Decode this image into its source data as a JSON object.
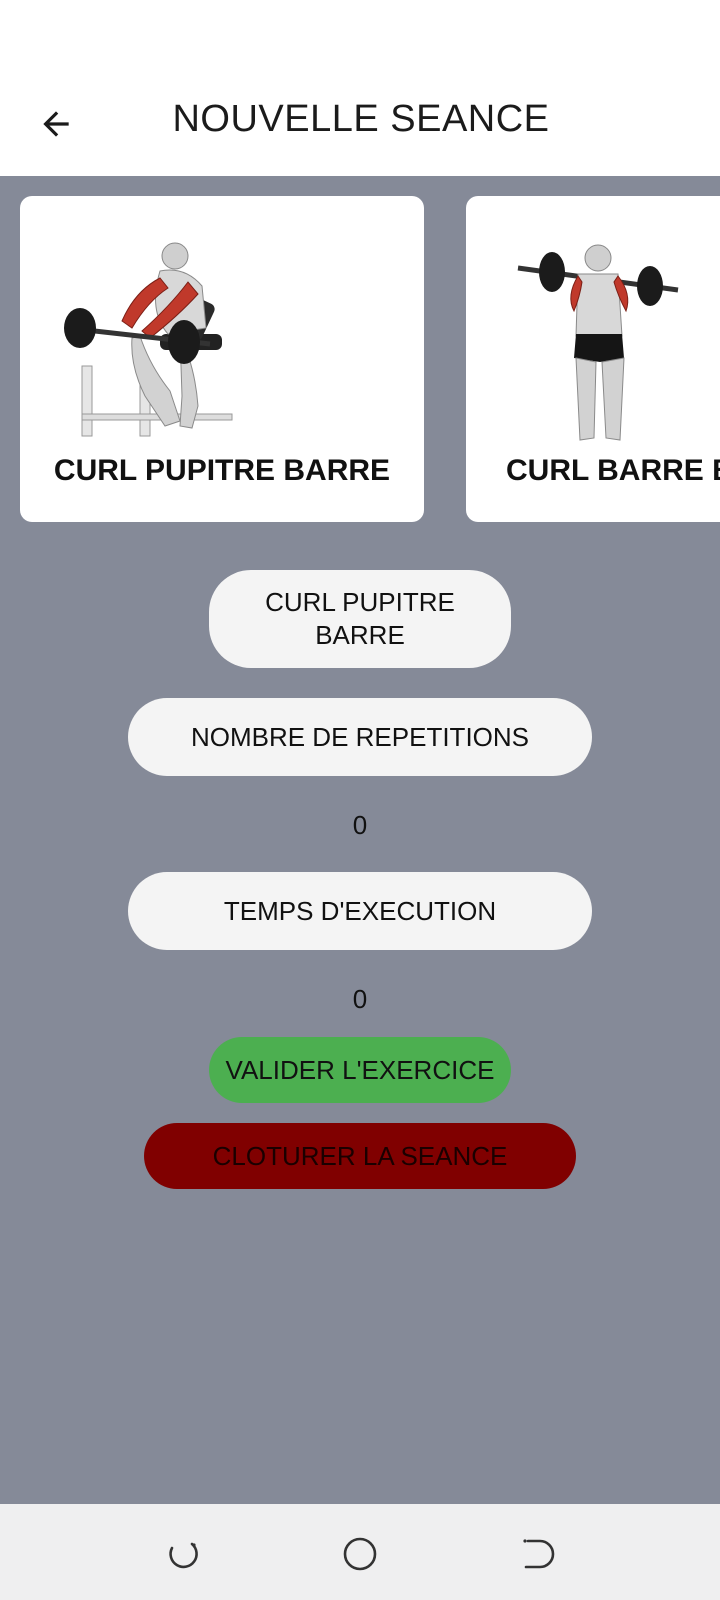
{
  "header": {
    "title": "NOUVELLE SEANCE",
    "back_icon": "arrow-back-icon"
  },
  "carousel": {
    "cards": [
      {
        "label": "CURL PUPITRE BARRE",
        "image_icon": "preacher-curl-illustration"
      },
      {
        "label": "CURL BARRE B",
        "image_icon": "barbell-curl-illustration"
      }
    ]
  },
  "form": {
    "exercise_name": "CURL PUPITRE BARRE",
    "reps_label": "NOMBRE DE REPETITIONS",
    "reps_value": "0",
    "time_label": "TEMPS D'EXECUTION",
    "time_value": "0",
    "validate_label": "VALIDER L'EXERCICE",
    "close_label": "CLOTURER LA SEANCE"
  },
  "colors": {
    "background": "#858a98",
    "validate": "#4caf50",
    "close": "#800000",
    "pill": "#f4f4f4"
  },
  "nav": {
    "recent_icon": "recent-apps-icon",
    "home_icon": "home-icon",
    "back_icon": "nav-back-icon"
  }
}
